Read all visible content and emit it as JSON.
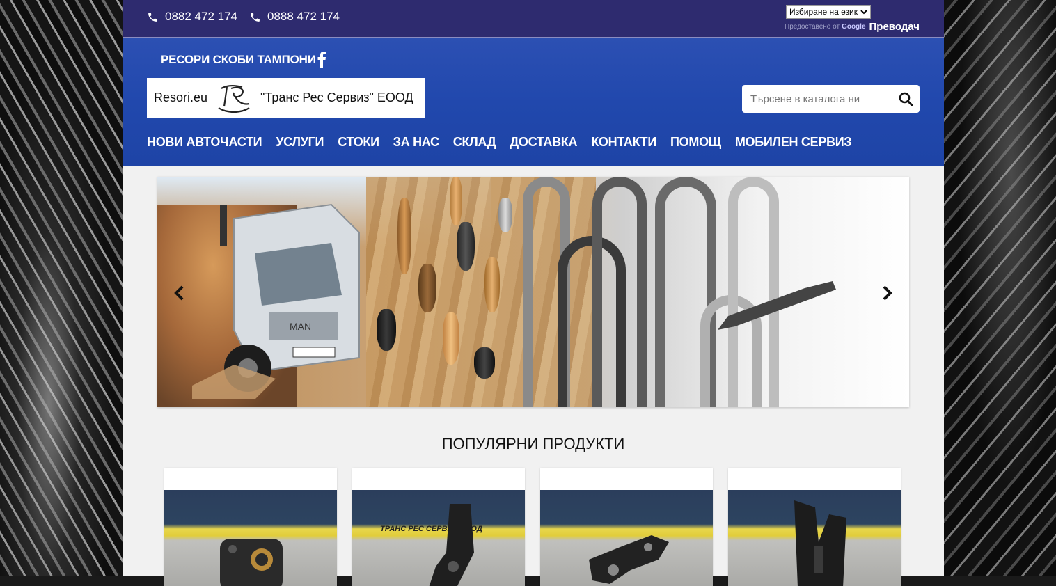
{
  "topbar": {
    "phones": [
      "0882 472 174",
      "0888 472 174"
    ],
    "language_select": "Избиране на език",
    "powered_by": "Предоставено от",
    "google": "Google",
    "translate": "Преводач"
  },
  "header": {
    "tagline": "РЕСОРИ СКОБИ ТАМПОНИ",
    "logo_site": "Resori.eu",
    "logo_company": "\"Транс Рес Сервиз\" ЕООД",
    "search_placeholder": "Търсене в каталога ни"
  },
  "nav": [
    "НОВИ АВТОЧАСТИ",
    "УСЛУГИ",
    "СТОКИ",
    "ЗА НАС",
    "СКЛАД",
    "ДОСТАВКА",
    "КОНТАКТИ",
    "ПОМОЩ",
    "МОБИЛЕН СЕРВИЗ"
  ],
  "popular": {
    "title": "ПОПУЛЯРНИ ПРОДУКТИ",
    "card_banner": "ТРАНС РЕС СЕРВИЗ ЕООД"
  },
  "icons": {
    "phone": "phone-icon",
    "facebook": "facebook-icon",
    "search": "search-icon",
    "prev": "chevron-left-icon",
    "next": "chevron-right-icon"
  },
  "colors": {
    "topbar": "#2e2b6f",
    "header": "#2148ad",
    "content": "#f1f1f1"
  }
}
